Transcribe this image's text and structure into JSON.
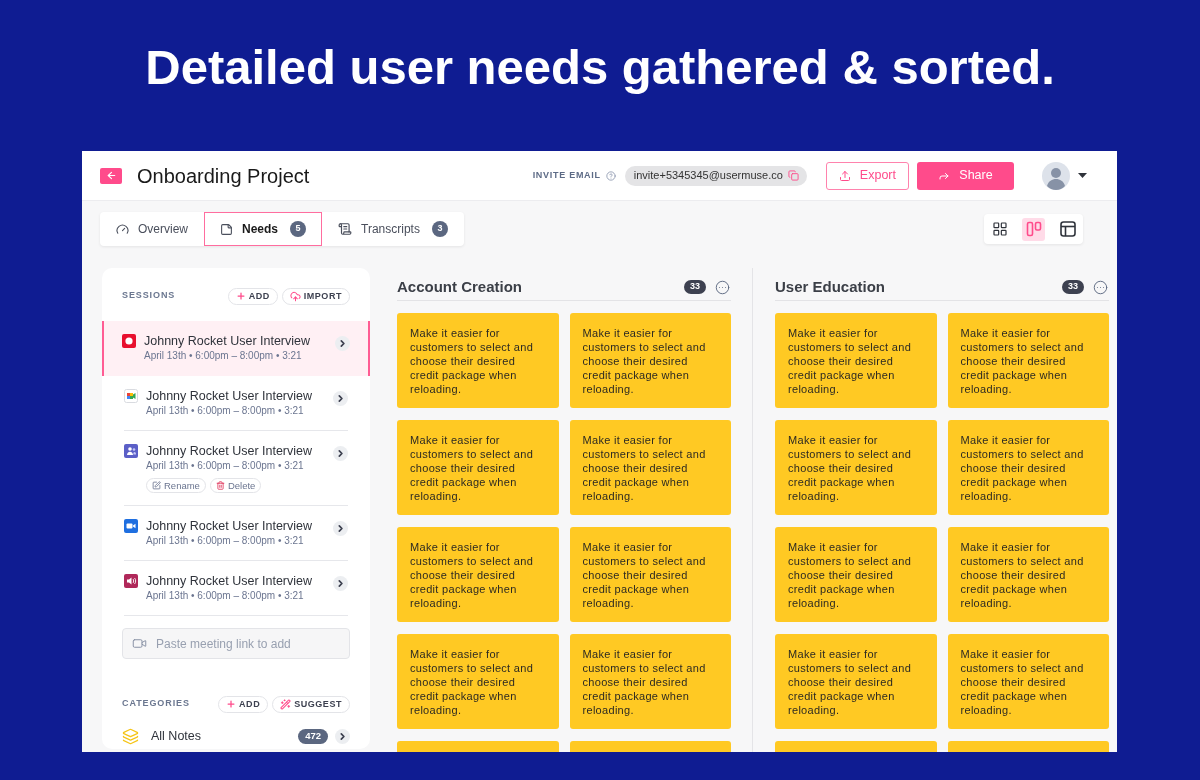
{
  "headline": "Detailed user needs gathered & sorted.",
  "header": {
    "title": "Onboarding Project",
    "invite_label": "INVITE EMAIL",
    "invite_email": "invite+5345345@usermuse.co",
    "buttons": [
      {
        "kind": "outline",
        "label": "Export"
      },
      {
        "kind": "filled",
        "label": "Share"
      }
    ]
  },
  "tabs": [
    {
      "kind": "overview",
      "label": "Overview",
      "selected": false
    },
    {
      "kind": "needs",
      "label": "Needs",
      "count": "5",
      "selected": true
    },
    {
      "kind": "transcripts",
      "label": "Transcripts",
      "count": "3",
      "selected": false
    }
  ],
  "view_modes": [
    {
      "kind": "grid",
      "selected": false
    },
    {
      "kind": "board",
      "selected": true
    },
    {
      "kind": "table",
      "selected": false
    }
  ],
  "sessions": {
    "label": "SESSIONS",
    "actions": [
      {
        "kind": "add",
        "label": "ADD"
      },
      {
        "kind": "import",
        "label": "IMPORT"
      }
    ],
    "items": [
      {
        "kind": "record",
        "title": "Johnny Rocket User Interview",
        "meta": "April 13th • 6:00pm – 8:00pm • 3:21",
        "selected": true
      },
      {
        "kind": "meet",
        "title": "Johnny Rocket User Interview",
        "meta": "April 13th • 6:00pm – 8:00pm • 3:21",
        "selected": false
      },
      {
        "kind": "teams",
        "title": "Johnny Rocket User Interview",
        "meta": "April 13th • 6:00pm – 8:00pm • 3:21",
        "selected": false,
        "actions": [
          {
            "kind": "rename",
            "label": "Rename"
          },
          {
            "kind": "delete",
            "label": "Delete"
          }
        ]
      },
      {
        "kind": "video",
        "title": "Johnny Rocket User Interview",
        "meta": "April 13th • 6:00pm – 8:00pm • 3:21",
        "selected": false
      },
      {
        "kind": "audio",
        "title": "Johnny Rocket User Interview",
        "meta": "April 13th • 6:00pm – 8:00pm • 3:21",
        "selected": false
      }
    ],
    "link_field": {
      "placeholder": "Paste meeting link to add"
    }
  },
  "categories": {
    "label": "CATEGORIES",
    "actions": [
      {
        "kind": "add",
        "label": "ADD"
      },
      {
        "kind": "suggest",
        "label": "SUGGEST"
      }
    ],
    "items": [
      {
        "label": "All Notes",
        "count": "472"
      }
    ]
  },
  "columns": [
    {
      "title": "Account Creation",
      "count": "33",
      "cards": [
        {
          "kind": "full",
          "text": "Make it easier for customers to select and choose their desired credit package when reloading."
        },
        {
          "kind": "full",
          "text": "Make it easier for customers to select and choose their desired credit package when reloading."
        },
        {
          "kind": "full",
          "text": "Make it easier for customers to select and choose their desired credit package when reloading."
        },
        {
          "kind": "full",
          "text": "Make it easier for customers to select and choose their desired credit package when reloading."
        },
        {
          "kind": "full",
          "text": "Make it easier for customers to select and choose their desired credit package when reloading."
        },
        {
          "kind": "full",
          "text": "Make it easier for customers to select and choose their desired credit package when reloading."
        },
        {
          "kind": "full",
          "text": "Make it easier for customers to select and choose their desired credit package when reloading."
        },
        {
          "kind": "full",
          "text": "Make it easier for customers to select and choose their desired credit package when reloading."
        },
        {
          "kind": "cut"
        },
        {
          "kind": "cut"
        }
      ]
    },
    {
      "title": "User Education",
      "count": "33",
      "cards": [
        {
          "kind": "full",
          "text": "Make it easier for customers to select and choose their desired credit package when reloading."
        },
        {
          "kind": "full",
          "text": "Make it easier for customers to select and choose their desired credit package when reloading."
        },
        {
          "kind": "full",
          "text": "Make it easier for customers to select and choose their desired credit package when reloading."
        },
        {
          "kind": "full",
          "text": "Make it easier for customers to select and choose their desired credit package when reloading."
        },
        {
          "kind": "full",
          "text": "Make it easier for customers to select and choose their desired credit package when reloading."
        },
        {
          "kind": "full",
          "text": "Make it easier for customers to select and choose their desired credit package when reloading."
        },
        {
          "kind": "full",
          "text": "Make it easier for customers to select and choose their desired credit package when reloading."
        },
        {
          "kind": "full",
          "text": "Make it easier for customers to select and choose their desired credit package when reloading."
        },
        {
          "kind": "cut"
        },
        {
          "kind": "cut"
        }
      ]
    }
  ]
}
